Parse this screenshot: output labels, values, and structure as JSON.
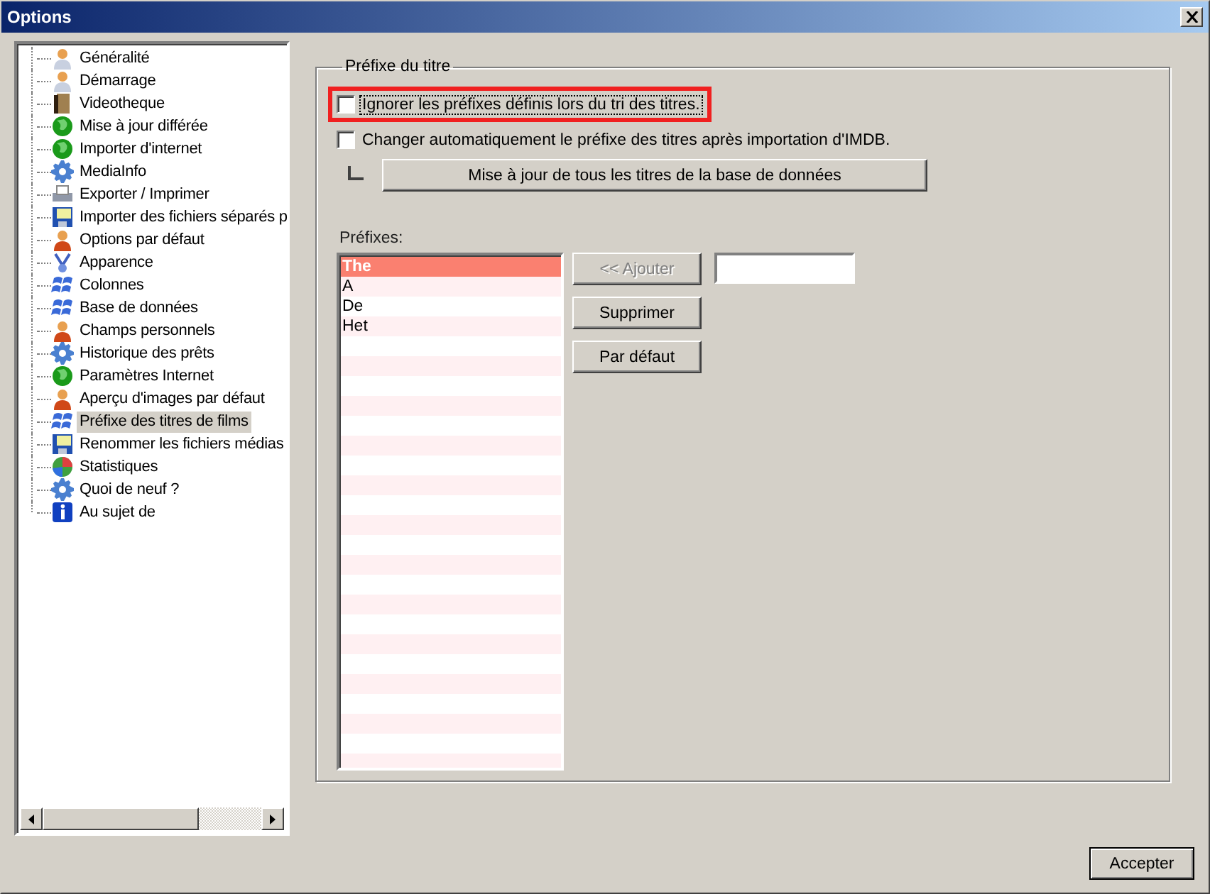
{
  "window": {
    "title": "Options"
  },
  "sidebar": {
    "items": [
      {
        "label": "Généralité",
        "selected": false
      },
      {
        "label": "Démarrage",
        "selected": false
      },
      {
        "label": "Videotheque",
        "selected": false
      },
      {
        "label": "Mise à jour différée",
        "selected": false
      },
      {
        "label": "Importer d'internet",
        "selected": false
      },
      {
        "label": "MediaInfo",
        "selected": false
      },
      {
        "label": "Exporter / Imprimer",
        "selected": false
      },
      {
        "label": "Importer des fichiers séparés p",
        "selected": false
      },
      {
        "label": "Options par défaut",
        "selected": false
      },
      {
        "label": "Apparence",
        "selected": false
      },
      {
        "label": "Colonnes",
        "selected": false
      },
      {
        "label": "Base de données",
        "selected": false
      },
      {
        "label": "Champs personnels",
        "selected": false
      },
      {
        "label": "Historique des prêts",
        "selected": false
      },
      {
        "label": "Paramètres Internet",
        "selected": false
      },
      {
        "label": "Aperçu d'images par défaut",
        "selected": false
      },
      {
        "label": "Préfixe des titres de films",
        "selected": true
      },
      {
        "label": "Renommer les fichiers médias",
        "selected": false
      },
      {
        "label": "Statistiques",
        "selected": false
      },
      {
        "label": "Quoi de neuf ?",
        "selected": false
      },
      {
        "label": "Au sujet de",
        "selected": false
      }
    ]
  },
  "group": {
    "title": "Préfixe du titre",
    "checkboxes": [
      {
        "label": "Ignorer les préfixes définis lors du tri des titres.",
        "checked": false,
        "highlighted": true
      },
      {
        "label": "Changer automatiquement le préfixe des titres après importation d'IMDB.",
        "checked": false,
        "highlighted": false
      }
    ],
    "update_button": "Mise à jour de tous les titres de la base de données",
    "prefixes_label": "Préfixes:",
    "prefixes": [
      {
        "label": "The",
        "selected": true
      },
      {
        "label": "A",
        "selected": false
      },
      {
        "label": "De",
        "selected": false
      },
      {
        "label": "Het",
        "selected": false
      }
    ],
    "buttons": [
      {
        "label": "<< Ajouter",
        "disabled": true
      },
      {
        "label": "Supprimer",
        "disabled": false
      },
      {
        "label": "Par défaut",
        "disabled": false
      }
    ]
  },
  "footer": {
    "ok_button": "Accepter"
  }
}
